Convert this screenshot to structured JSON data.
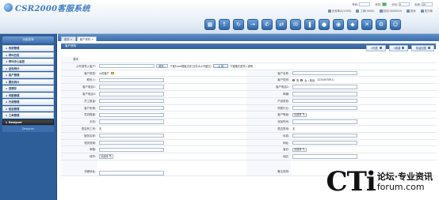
{
  "header": {
    "app_title": "CSR2000客服系统",
    "info1": [
      {
        "label": "号码:",
        "value": ""
      },
      {
        "label": "状态:",
        "value": ""
      },
      {
        "label": "分机:",
        "value": "9"
      },
      {
        "label": "坐席:",
        "value": "29"
      }
    ],
    "info2": [
      {
        "label": "业务单(0/1000)"
      },
      {
        "label": "工单(0000)"
      },
      {
        "label": "回访(00/0000)"
      },
      {
        "label": "投诉"
      },
      {
        "label": "知识库"
      }
    ],
    "toolbar_icons": [
      "calendar-icon",
      "up-arrow-icon",
      "refresh-icon",
      "right-arrow-icon",
      "phone-icon",
      "transfer-icon",
      "chat-icon",
      "hold-icon",
      "mute-icon",
      "speaker-icon",
      "record-icon",
      "hangup-icon",
      "settings-icon",
      "user-icon"
    ]
  },
  "sidebar": {
    "title": "功能菜单",
    "items": [
      {
        "label": "系统管理"
      },
      {
        "label": "呼叫日志"
      },
      {
        "label": "呼叫中心监控"
      },
      {
        "label": "话务统计"
      },
      {
        "label": "客户管理"
      },
      {
        "label": "服务统计"
      },
      {
        "label": "进销存"
      },
      {
        "label": "考勤管理"
      },
      {
        "label": "外拨管理"
      },
      {
        "label": "短信管理"
      },
      {
        "label": "工单管理"
      }
    ],
    "designer": "Designer",
    "designer_sub": "Designer"
  },
  "tabs": [
    {
      "label": "首页"
    },
    {
      "label": "客户资料"
    }
  ],
  "panel": {
    "title": "客户资料",
    "actions": [
      {
        "label": "<列表"
      },
      {
        "label": "+新增"
      },
      {
        "label": "电话回拨"
      }
    ]
  },
  "form": {
    "basic_label": "基本",
    "upload": {
      "label": "从外部导入客户:",
      "browse": "浏览...",
      "hint1": "下载Excel模板文件(文件大小不超过)",
      "upload_btn": "上 传",
      "hint2": "下载格式或导入说明"
    },
    "rows": [
      {
        "l1": "客户类型:",
        "v1": "公司客户",
        "l2": "客户名称:",
        "v2": ""
      },
      {
        "l1": "联系人:",
        "v1": "",
        "l2": "客户性别:",
        "v2": "男",
        "v2b": "女",
        "v2c": "(电话:",
        "v2d": "1234567891)"
      },
      {
        "l1": "客户电话1:",
        "v1": "",
        "l2": "客户电话2:",
        "v2": ""
      },
      {
        "l1": "客户电话3:",
        "v1": "",
        "l2": "邮编:",
        "v2": ""
      },
      {
        "l1": "员工数量:",
        "v1": "",
        "l2": "产品类型:",
        "v2": ""
      },
      {
        "l1": "客户来源:",
        "v1": "",
        "l2": "所属行业:",
        "v2": ""
      },
      {
        "l1": "意向程度:",
        "v1": "",
        "l2": "客户等级:",
        "v2": "请选择"
      },
      {
        "l1": "手机:",
        "v1": "",
        "l2": "添加时间:",
        "v2": ""
      },
      {
        "l1": "是否有工号:",
        "v1": "无",
        "l2": "是否禁用:",
        "v2": "无"
      },
      {
        "l1": "服务名称:",
        "v1": "",
        "l2": "传真:",
        "v2": ""
      },
      {
        "l1": "相关档案:",
        "v1": "",
        "l2": "网址:",
        "v2": ""
      },
      {
        "l1": "邮箱:",
        "v1": "",
        "l2": "省份:",
        "v2": "请选择"
      },
      {
        "l1": "城市:",
        "v1": "请选择",
        "l2": "地区:",
        "v2": ""
      }
    ],
    "last_row": {
      "l1": "详细地址:",
      "l2": "备注说明:"
    }
  },
  "watermark": {
    "big": "CTi",
    "cn": "论坛·专业资讯",
    "url": "forum.com"
  }
}
